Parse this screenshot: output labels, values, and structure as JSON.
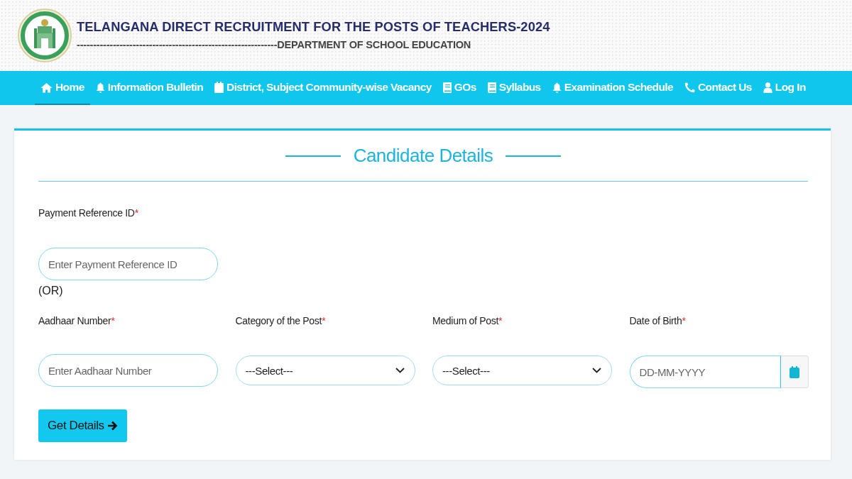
{
  "header": {
    "title": "TELANGANA DIRECT RECRUITMENT FOR THE POSTS OF TEACHERS-2024",
    "subtitle": "-------------------------------------------------------------DEPARTMENT OF SCHOOL EDUCATION"
  },
  "nav": [
    {
      "label": "Home",
      "kind": "home",
      "selected": true
    },
    {
      "label": "Information Bulletin",
      "kind": "notice",
      "selected": false
    },
    {
      "label": "District, Subject Community-wise Vacancy",
      "kind": "listing",
      "selected": false
    },
    {
      "label": "GOs",
      "kind": "document",
      "selected": false
    },
    {
      "label": "Syllabus",
      "kind": "document",
      "selected": false
    },
    {
      "label": "Examination Schedule",
      "kind": "notice",
      "selected": false
    },
    {
      "label": "Contact Us",
      "kind": "contact",
      "selected": false
    },
    {
      "label": "Log In",
      "kind": "account",
      "selected": false
    }
  ],
  "form": {
    "title": "Candidate Details",
    "payment": {
      "label": "Payment Reference ID",
      "required_mark": "*",
      "placeholder": "Enter Payment Reference ID"
    },
    "or_text": "(OR)",
    "fields": [
      {
        "kind": "text",
        "label": "Aadhaar Number",
        "required_mark": "*",
        "placeholder": "Enter Aadhaar Number"
      },
      {
        "kind": "select",
        "label": "Category of the Post",
        "required_mark": "*",
        "value": "---Select---"
      },
      {
        "kind": "select",
        "label": "Medium of Post",
        "required_mark": "*",
        "value": "---Select---"
      },
      {
        "kind": "date",
        "label": "Date of Birth",
        "required_mark": "*",
        "placeholder": "DD-MM-YYYY"
      }
    ],
    "button": "Get Details"
  }
}
